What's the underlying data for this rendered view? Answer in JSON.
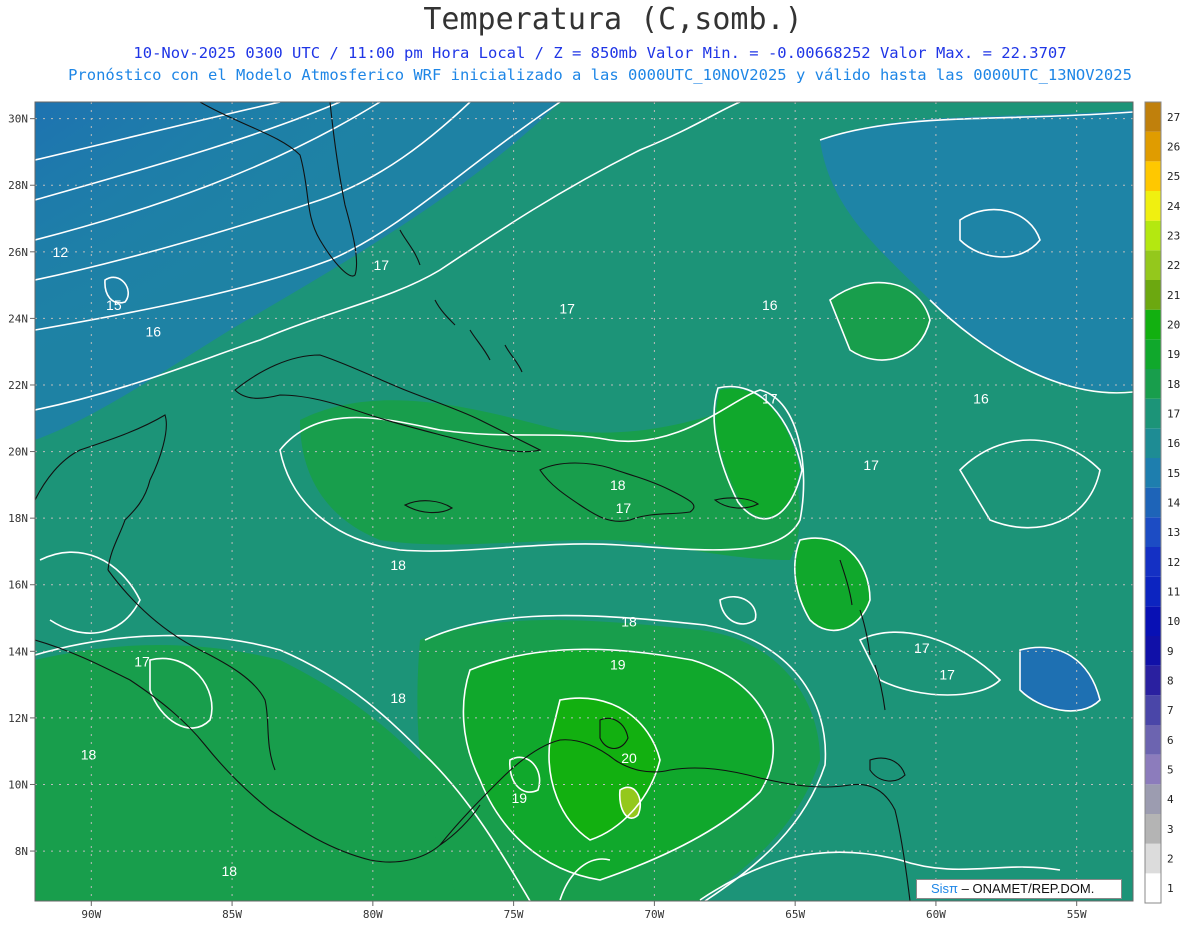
{
  "title": "Temperatura (C,somb.)",
  "subtitle1": "10-Nov-2025  0300 UTC / 11:00 pm Hora Local / Z = 850mb Valor Min. = -0.00668252  Valor Max. = 22.3707",
  "subtitle2": "Pronóstico con el Modelo Atmosferico WRF inicializado a las 0000UTC_10NOV2025 y válido hasta las  0000UTC_13NOV2025",
  "credit": {
    "sis": "Sisπ",
    "org": " – ONAMET/REP.DOM."
  },
  "map": {
    "lon_range": [
      -92,
      -53
    ],
    "lat_range": [
      6.5,
      30.5
    ],
    "lon_ticks": [
      "90W",
      "85W",
      "80W",
      "75W",
      "70W",
      "65W",
      "60W",
      "55W"
    ],
    "lat_ticks": [
      "30N",
      "28N",
      "26N",
      "24N",
      "22N",
      "20N",
      "18N",
      "16N",
      "14N",
      "12N",
      "10N",
      "8N"
    ],
    "grid": true,
    "colorbar": {
      "levels": [
        "1",
        "2",
        "3",
        "4",
        "5",
        "6",
        "7",
        "8",
        "9",
        "10",
        "11",
        "12",
        "13",
        "14",
        "15",
        "16",
        "17",
        "18",
        "19",
        "20",
        "21",
        "22",
        "23",
        "24",
        "25",
        "26",
        "27"
      ],
      "colors": [
        "#ffffff",
        "#dcdcdc",
        "#b4b4b4",
        "#9c9cb0",
        "#8c7cbc",
        "#6c64b0",
        "#4a46a8",
        "#2a20a0",
        "#1010a8",
        "#0810b4",
        "#0c24c0",
        "#1430c4",
        "#1c4cc4",
        "#1e64b8",
        "#1e7eae",
        "#1e8c94",
        "#1c9478",
        "#189e4c",
        "#10a82c",
        "#12b010",
        "#6ca810",
        "#94c81c",
        "#b4e810",
        "#f0f010",
        "#ffc800",
        "#e09c00",
        "#c0800c"
      ],
      "side": "right"
    },
    "contour_labels": [
      {
        "text": "12",
        "lon": -91.1,
        "lat": 26.0
      },
      {
        "text": "15",
        "lon": -89.2,
        "lat": 24.4
      },
      {
        "text": "16",
        "lon": -87.8,
        "lat": 23.6
      },
      {
        "text": "17",
        "lon": -79.7,
        "lat": 25.6
      },
      {
        "text": "17",
        "lon": -73.1,
        "lat": 24.3
      },
      {
        "text": "16",
        "lon": -65.9,
        "lat": 24.4
      },
      {
        "text": "17",
        "lon": -65.9,
        "lat": 21.6
      },
      {
        "text": "16",
        "lon": -58.4,
        "lat": 21.6
      },
      {
        "text": "17",
        "lon": -62.3,
        "lat": 19.6
      },
      {
        "text": "18",
        "lon": -71.3,
        "lat": 19.0
      },
      {
        "text": "17",
        "lon": -71.1,
        "lat": 18.3
      },
      {
        "text": "18",
        "lon": -79.1,
        "lat": 16.6
      },
      {
        "text": "18",
        "lon": -70.9,
        "lat": 14.9
      },
      {
        "text": "19",
        "lon": -71.3,
        "lat": 13.6
      },
      {
        "text": "18",
        "lon": -79.1,
        "lat": 12.6
      },
      {
        "text": "17",
        "lon": -88.2,
        "lat": 13.7
      },
      {
        "text": "17",
        "lon": -60.5,
        "lat": 14.1
      },
      {
        "text": "17",
        "lon": -59.6,
        "lat": 13.3
      },
      {
        "text": "20",
        "lon": -70.9,
        "lat": 10.8
      },
      {
        "text": "19",
        "lon": -74.8,
        "lat": 9.6
      },
      {
        "text": "18",
        "lon": -90.1,
        "lat": 10.9
      },
      {
        "text": "18",
        "lon": -85.1,
        "lat": 7.4
      }
    ]
  }
}
